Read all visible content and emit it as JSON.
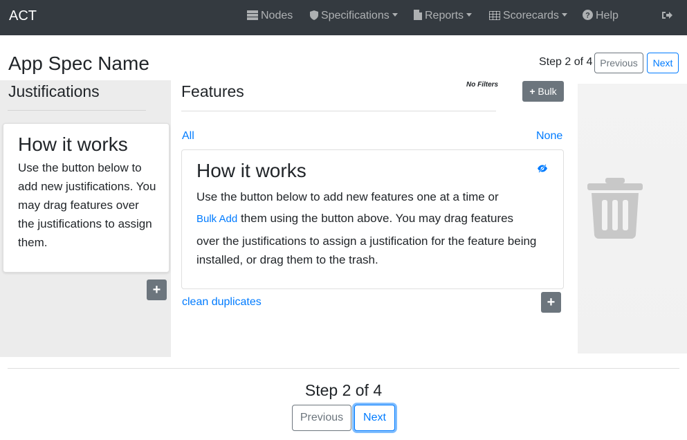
{
  "navbar": {
    "brand": "ACT",
    "items": [
      {
        "label": "Nodes",
        "icon": "server-icon"
      },
      {
        "label": "Specifications",
        "icon": "shield-icon"
      },
      {
        "label": "Reports",
        "icon": "file-icon"
      },
      {
        "label": "Scorecards",
        "icon": "table-icon"
      },
      {
        "label": "Help",
        "icon": "question-circle-icon"
      }
    ],
    "signout_icon": "sign-out-icon"
  },
  "header": {
    "title": "App Spec Name",
    "step_text": "Step 2 of 4",
    "previous_label": "Previous",
    "next_label": "Next"
  },
  "justifications": {
    "title": "Justifications",
    "card": {
      "heading": "How it works",
      "text": "Use the button below to add new justifications. You may drag features over the justifications to assign them."
    },
    "add_icon": "plus-icon"
  },
  "features": {
    "title": "Features",
    "filter_text": "No Filters",
    "bulk_label": "Bulk",
    "all_label": "All",
    "none_label": "None",
    "card": {
      "heading": "How it works",
      "text_before": "Use the button below to add new features one at a time or",
      "bulk_add_link": "Bulk Add",
      "text_after_1": "them using the button above. You may drag features",
      "text_after_2": "over the justifications to assign a justification for the feature being installed, or drag them to the trash."
    },
    "clean_duplicates": "clean duplicates",
    "eye_icon": "eye-slash-icon",
    "add_icon": "plus-icon"
  },
  "trash": {
    "icon": "trash-icon"
  },
  "footer": {
    "step_text": "Step 2 of 4",
    "previous_label": "Previous",
    "next_label": "Next"
  },
  "colors": {
    "navbar": "#343a40",
    "primary": "#007bff",
    "secondary": "#6c757d",
    "panel": "#ececec"
  }
}
